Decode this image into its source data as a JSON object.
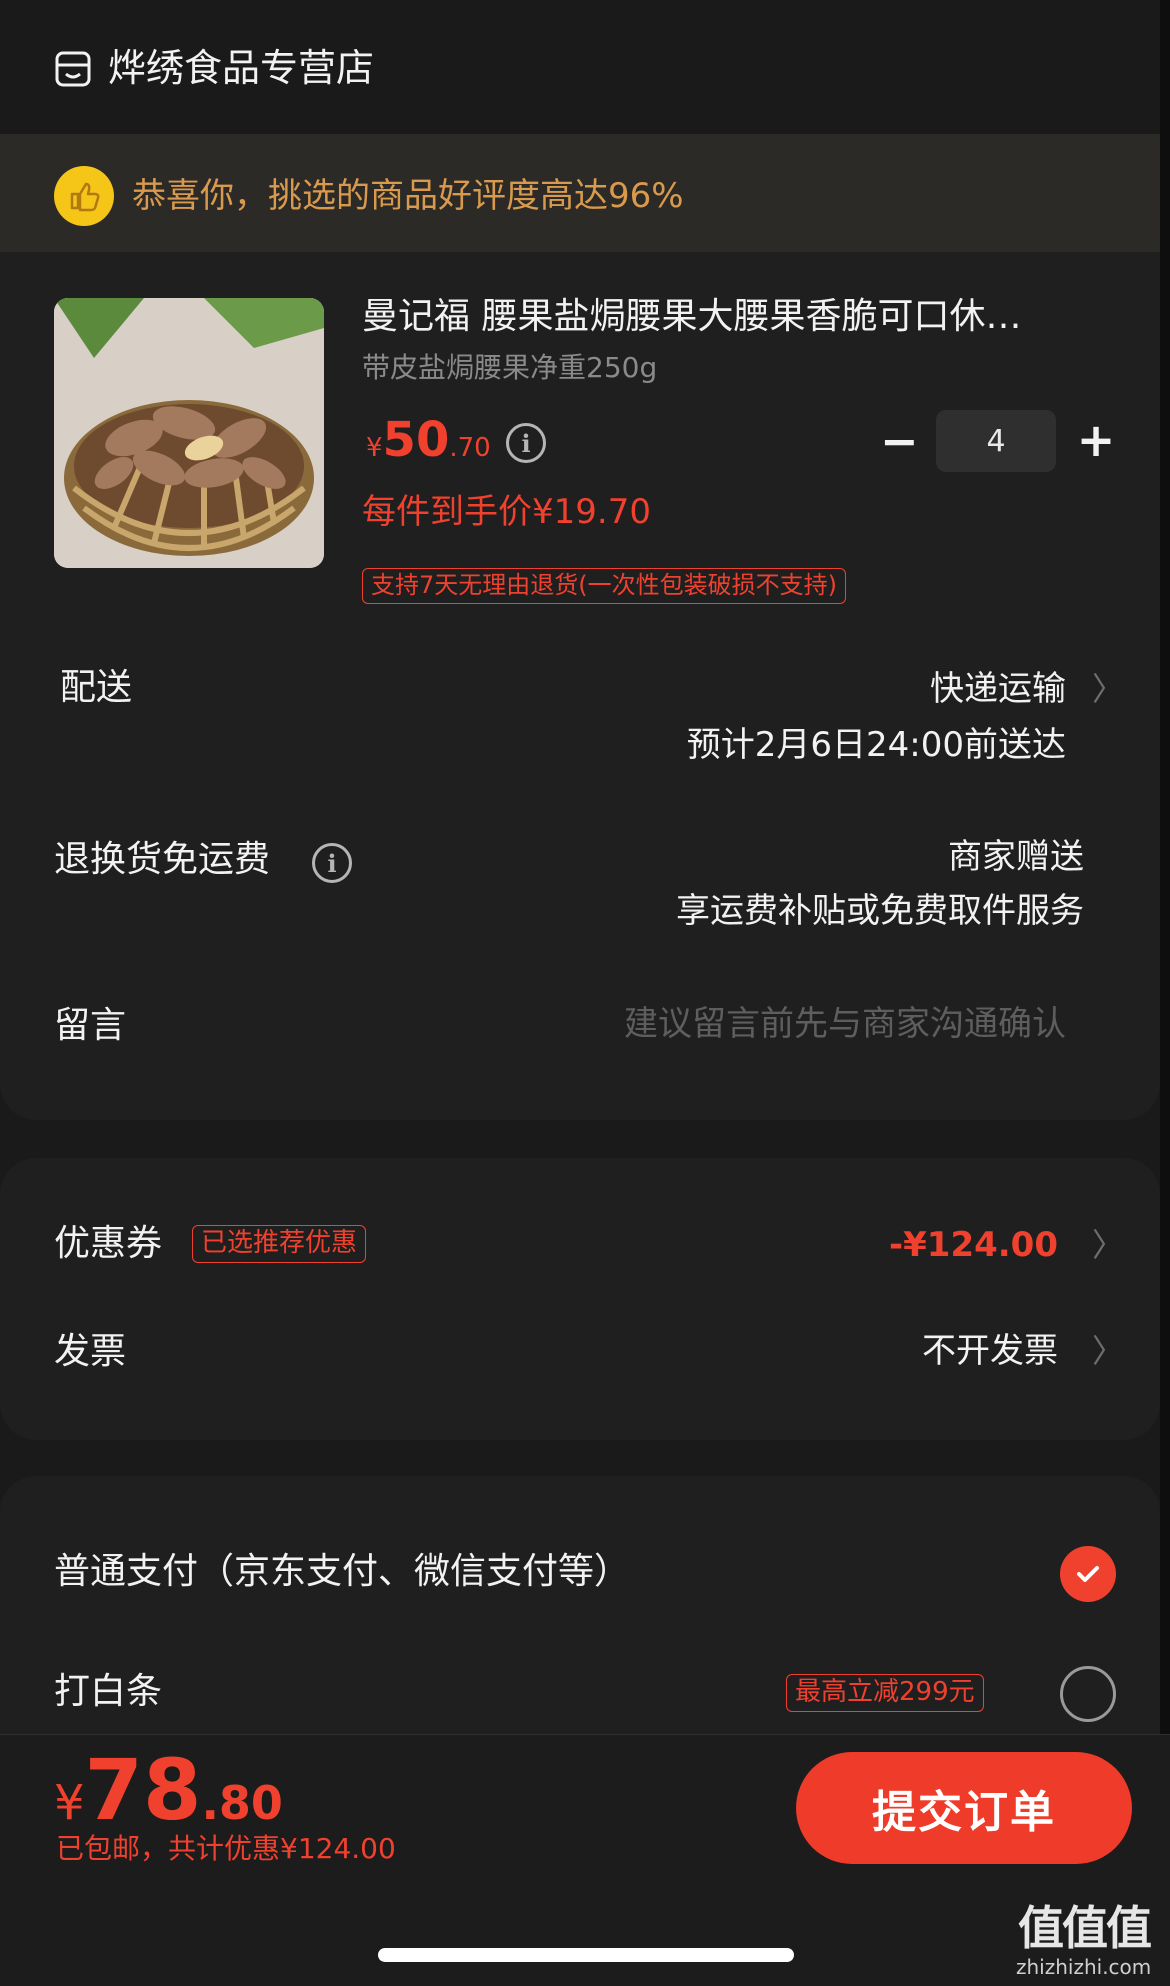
{
  "store": {
    "name": "烨绣食品专营店",
    "icon": "store-icon"
  },
  "praise": {
    "text": "恭喜你，挑选的商品好评度高达96%",
    "icon": "thumbs-up-icon"
  },
  "product": {
    "title": "曼记福 腰果盐焗腰果大腰果香脆可口休…",
    "spec": "带皮盐焗腰果净重250g",
    "price_symbol": "¥",
    "price_int": "50",
    "price_dec": ".70",
    "quantity": "4",
    "minus": "−",
    "plus": "+",
    "unit_price": "每件到手价¥19.70",
    "return_policy": "支持7天无理由退货(一次性包装破损不支持)"
  },
  "shipping": {
    "label": "配送",
    "method": "快递运输",
    "eta": "预计2月6日24:00前送达"
  },
  "return_shipping": {
    "label": "退换货免运费",
    "value1": "商家赠送",
    "value2": "享运费补贴或免费取件服务"
  },
  "message": {
    "label": "留言",
    "placeholder": "建议留言前先与商家沟通确认"
  },
  "coupon": {
    "label": "优惠券",
    "tag": "已选推荐优惠",
    "amount": "-¥124.00"
  },
  "invoice": {
    "label": "发票",
    "value": "不开发票"
  },
  "payment": {
    "option1": "普通支付（京东支付、微信支付等）",
    "option1_selected": true,
    "option2": "打白条",
    "option2_tag": "最高立减299元",
    "option2_selected": false
  },
  "footer": {
    "total_symbol": "¥",
    "total_int": "78",
    "total_dec": ".80",
    "note": "已包邮，共计优惠¥124.00",
    "submit": "提交订单"
  },
  "watermark": {
    "cn": "值值值",
    "en": "zhizhizhi.com"
  },
  "colors": {
    "accent": "#f0412e",
    "background": "#1a1a1a",
    "card": "#1f1f1f",
    "praise_text": "#d99a4e",
    "praise_icon": "#f5c518"
  }
}
